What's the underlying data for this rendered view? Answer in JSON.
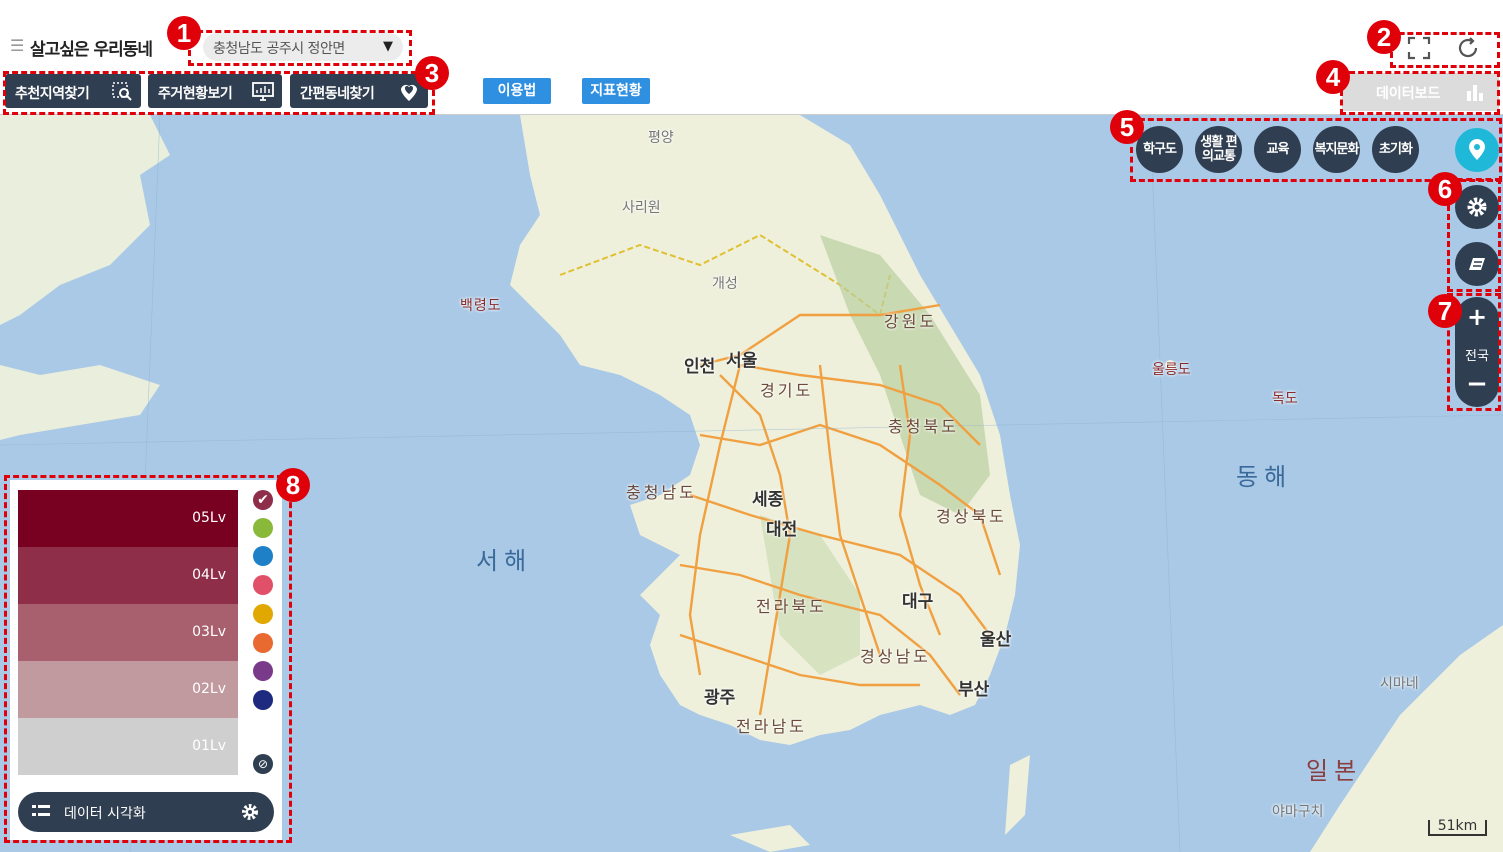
{
  "header": {
    "title": "살고싶은 우리동네",
    "region": "충청남도 공주시 정안면"
  },
  "toolbar": {
    "recommend": "추천지역찾기",
    "housing": "주거현황보기",
    "simple": "간편동네찾기",
    "usage": "이용법",
    "indicator": "지표현황",
    "dashboard": "데이터보드"
  },
  "categories": [
    "학구도",
    "생활 편의교통",
    "교육",
    "복지문화",
    "초기화"
  ],
  "zoom": {
    "label": "전국",
    "plus": "+",
    "minus": "−"
  },
  "legend": {
    "levels": [
      "05Lv",
      "04Lv",
      "03Lv",
      "02Lv",
      "01Lv"
    ],
    "level_colors": [
      "#780020",
      "#8e2e48",
      "#a8606e",
      "#c19aa0",
      "#cfcfcf"
    ],
    "swatch_colors": [
      "#8e2e48",
      "#8ab83a",
      "#1e80c6",
      "#e05068",
      "#e0a800",
      "#e86a30",
      "#7a3a8a",
      "#1e2a80"
    ],
    "viz_label": "데이터 시각화"
  },
  "map_labels": {
    "pyongyang": "평양",
    "sariwon": "사리원",
    "kaesong": "개성",
    "baengnyeong": "백령도",
    "gangwon": "강원도",
    "incheon": "인천",
    "seoul": "서울",
    "gyeonggi": "경기도",
    "ulleung": "울릉도",
    "dokdo": "독도",
    "chungbuk": "충청북도",
    "chungnam": "충청남도",
    "sejong": "세종",
    "daejeon": "대전",
    "gyeongbuk": "경상북도",
    "east_sea": "동해",
    "west_sea": "서해",
    "jeonbuk": "전라북도",
    "daegu": "대구",
    "ulsan": "울산",
    "gyeongnam": "경상남도",
    "busan": "부산",
    "gwangju": "광주",
    "jeonnam": "전라남도",
    "shimane": "시마네",
    "japan": "일본",
    "yamaguchi": "야마구치",
    "scale": "51km"
  },
  "callouts": [
    "1",
    "2",
    "3",
    "4",
    "5",
    "6",
    "7",
    "8"
  ]
}
